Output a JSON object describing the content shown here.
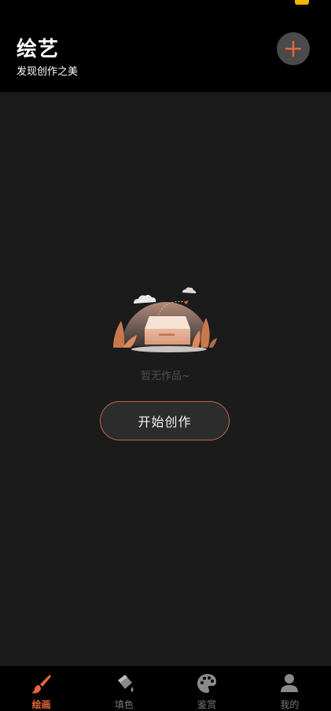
{
  "header": {
    "title": "绘艺",
    "subtitle": "发现创作之美"
  },
  "colors": {
    "accent": "#e8673a",
    "header_bg": "#000000",
    "body_bg": "#1b1b1b",
    "button_border": "#c2664a"
  },
  "empty_state": {
    "message": "暂无作品~",
    "illustration_icon": "empty-box-illustration",
    "cta_label": "开始创作"
  },
  "tabbar": {
    "items": [
      {
        "label": "绘画",
        "icon": "brush-icon",
        "active": true
      },
      {
        "label": "填色",
        "icon": "paint-bucket-icon",
        "active": false
      },
      {
        "label": "鉴赏",
        "icon": "palette-icon",
        "active": false
      },
      {
        "label": "我的",
        "icon": "user-icon",
        "active": false
      }
    ]
  }
}
